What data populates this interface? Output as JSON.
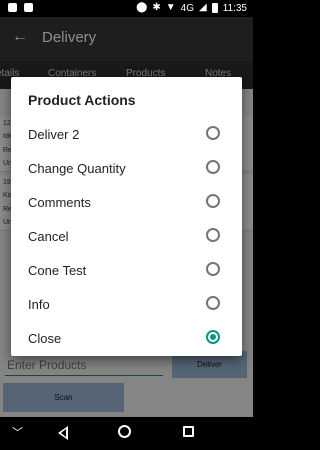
{
  "status": {
    "network": "4G",
    "time": "11:35"
  },
  "toolbar": {
    "back_icon": "arrow-left-icon",
    "title": "Delivery"
  },
  "tabs": [
    "etails",
    "Containers",
    "Products",
    "Notes"
  ],
  "behind": {
    "rows": [
      {
        "l1": "12",
        "l2": "Ide",
        "l3": "Re",
        "l4": "Un"
      },
      {
        "l1": "19",
        "l2": "Ko",
        "l3": "Re",
        "l4": "Un"
      }
    ],
    "input_placeholder": "Enter Products",
    "deliver_label": "Deliver",
    "scan_label": "Scan"
  },
  "dialog": {
    "title": "Product Actions",
    "options": [
      {
        "label": "Deliver 2",
        "checked": false
      },
      {
        "label": "Change Quantity",
        "checked": false
      },
      {
        "label": "Comments",
        "checked": false
      },
      {
        "label": "Cancel",
        "checked": false
      },
      {
        "label": "Cone Test",
        "checked": false
      },
      {
        "label": "Info",
        "checked": false
      },
      {
        "label": "Close",
        "checked": true
      }
    ]
  },
  "colors": {
    "accent": "#009688",
    "toolbar": "#383838",
    "button": "#9cb8d8"
  }
}
